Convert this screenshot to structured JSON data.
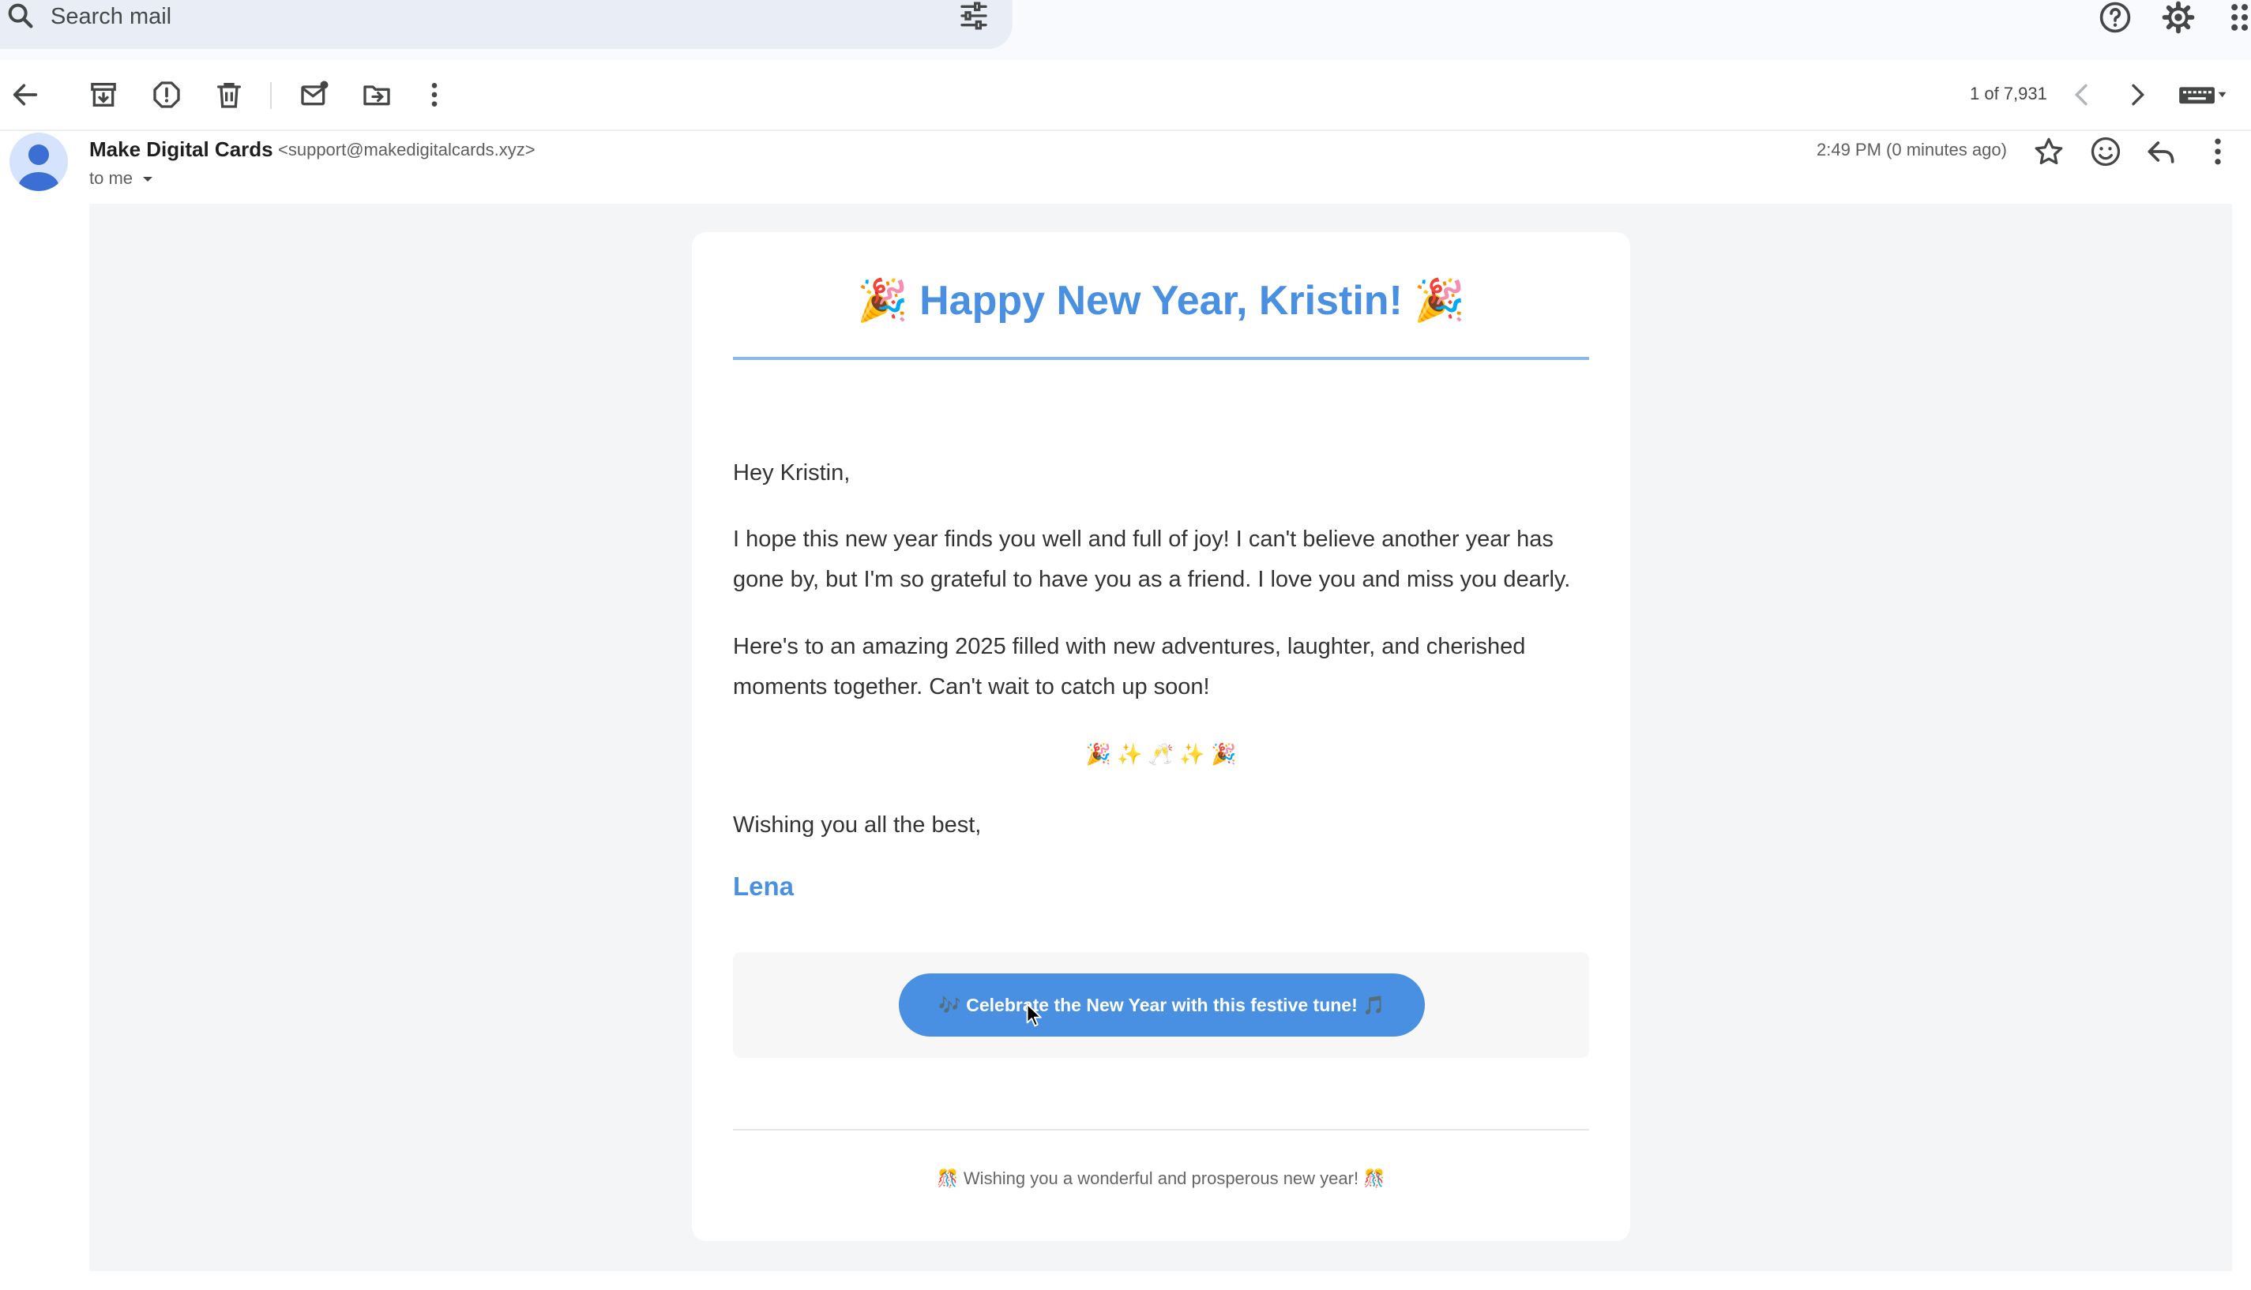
{
  "search": {
    "placeholder": "Search mail"
  },
  "toolbar": {
    "page_count": "1 of 7,931"
  },
  "email": {
    "sender_name": "Make Digital Cards",
    "sender_email": "<support@makedigitalcards.xyz>",
    "recipient": "to me",
    "timestamp": "2:49 PM (0 minutes ago)"
  },
  "card": {
    "title": "🎉 Happy New Year, Kristin! 🎉",
    "greeting": "Hey Kristin,",
    "paragraph1": "I hope this new year finds you well and full of joy! I can't believe another year has gone by, but I'm so grateful to have you as a friend. I love you and miss you dearly.",
    "paragraph2": "Here's to an amazing 2025 filled with new adventures, laughter, and cherished moments together. Can't wait to catch up soon!",
    "emoji_row": "🎉 ✨ 🥂 ✨ 🎉",
    "closing": "Wishing you all the best,",
    "signature": "Lena",
    "cta_label": "🎶 Celebrate the New Year with this festive tune! 🎵",
    "footer": "🎊 Wishing you a wonderful and prosperous new year! 🎊"
  },
  "colors": {
    "accent_blue": "#4a90e2",
    "search_bg": "#e9eef6",
    "message_bg": "#f4f5f6"
  },
  "icons": [
    "search-icon",
    "filter-icon",
    "help-icon",
    "settings-icon",
    "apps-grid-icon",
    "back-arrow-icon",
    "archive-icon",
    "report-spam-icon",
    "trash-icon",
    "mark-unread-icon",
    "move-to-icon",
    "more-vert-icon",
    "chevron-left-icon",
    "chevron-right-icon",
    "keyboard-icon",
    "star-icon",
    "emoji-icon",
    "reply-icon",
    "avatar-person-icon",
    "cursor-icon"
  ]
}
